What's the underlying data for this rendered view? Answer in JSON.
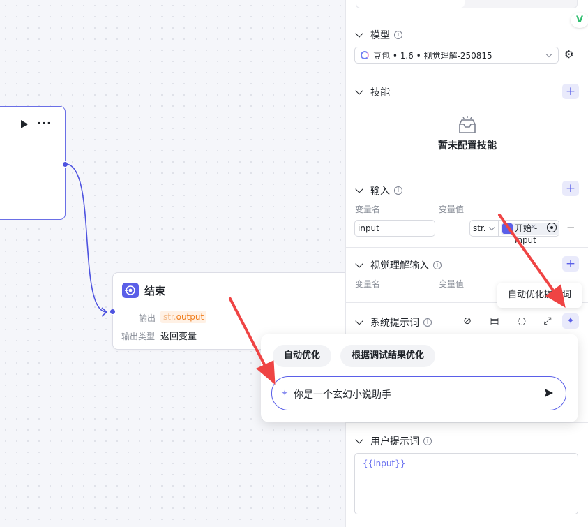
{
  "canvas": {
    "end_node": {
      "title": "结束",
      "output_label": "输出",
      "output_type_prefix": "str.",
      "output_var": "output",
      "output_type_label": "输出类型",
      "output_type_value": "返回变量"
    }
  },
  "panel": {
    "model": {
      "section_title": "模型",
      "selected": "豆包 • 1.6 • 视觉理解-250815"
    },
    "skills": {
      "section_title": "技能",
      "empty_text": "暂未配置技能"
    },
    "input": {
      "section_title": "输入",
      "col_name": "变量名",
      "col_value": "变量值",
      "row": {
        "name": "input",
        "type": "str.",
        "ref_node": "开始",
        "ref_separator": " - ",
        "ref_var": "input"
      }
    },
    "vision_input": {
      "section_title": "视觉理解输入",
      "col_name": "变量名",
      "col_value": "变量值"
    },
    "system_prompt": {
      "section_title": "系统提示词",
      "tooltip": "自动优化提示词"
    },
    "user_prompt": {
      "section_title": "用户提示词",
      "value": "{{input}}"
    }
  },
  "optimize_popup": {
    "chip_auto": "自动优化",
    "chip_debug": "根据调试结果优化",
    "input_value": "你是一个玄幻小说助手"
  },
  "colors": {
    "accent": "#5a5fe8",
    "annotation_arrow": "#ef4444",
    "output_tag": "#f07c1a"
  }
}
